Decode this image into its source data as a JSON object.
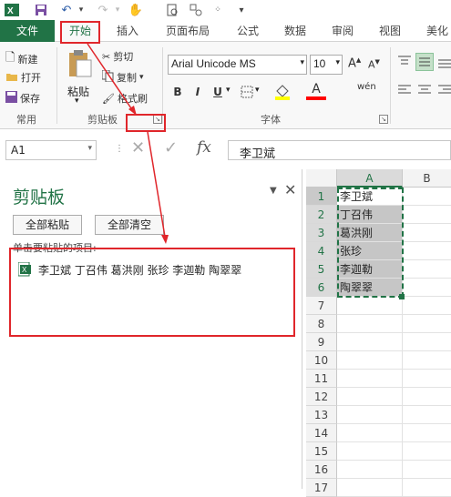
{
  "qat": {
    "excel_icon": "excel-icon",
    "save_icon": "save-icon",
    "undo_icon": "undo-icon",
    "redo_icon": "redo-icon",
    "touch_icon": "touch-mode-icon",
    "preview_icon": "print-preview-icon",
    "more_icon": "customize-icon"
  },
  "tabs": [
    "文件",
    "开始",
    "插入",
    "页面布局",
    "公式",
    "数据",
    "审阅",
    "视图",
    "美化"
  ],
  "ribbon": {
    "new_label": "新建",
    "open_label": "打开",
    "save_label": "保存",
    "group_common": "常用",
    "paste_label": "粘贴",
    "cut_label": "剪切",
    "copy_label": "复制",
    "format_painter_label": "格式刷",
    "group_clipboard": "剪贴板",
    "font_name": "Arial Unicode MS",
    "font_size": "10",
    "bold": "B",
    "italic": "I",
    "underline": "U",
    "font_color_letter": "A",
    "group_font": "字体",
    "phonetic": "wén"
  },
  "formula": {
    "name_box": "A1",
    "fx": "fx",
    "value": "李卫斌"
  },
  "pane": {
    "title": "剪贴板",
    "paste_all": "全部粘贴",
    "clear_all": "全部清空",
    "hint": "单击要粘贴的项目:",
    "item_text": "李卫斌 丁召伟 葛洪刚 张珍 李迦勒 陶翠翠"
  },
  "grid": {
    "col_a": "A",
    "col_b": "B",
    "rows": [
      {
        "n": "1",
        "a": "李卫斌"
      },
      {
        "n": "2",
        "a": "丁召伟"
      },
      {
        "n": "3",
        "a": "葛洪刚"
      },
      {
        "n": "4",
        "a": "张珍"
      },
      {
        "n": "5",
        "a": "李迦勒"
      },
      {
        "n": "6",
        "a": "陶翠翠"
      },
      {
        "n": "7",
        "a": ""
      },
      {
        "n": "8",
        "a": ""
      },
      {
        "n": "9",
        "a": ""
      },
      {
        "n": "10",
        "a": ""
      },
      {
        "n": "11",
        "a": ""
      },
      {
        "n": "12",
        "a": ""
      },
      {
        "n": "13",
        "a": ""
      },
      {
        "n": "14",
        "a": ""
      },
      {
        "n": "15",
        "a": ""
      },
      {
        "n": "16",
        "a": ""
      },
      {
        "n": "17",
        "a": ""
      }
    ]
  },
  "colors": {
    "accent": "#217346",
    "annotation": "#e0262b",
    "selection_fill": "#c6c6c6"
  }
}
